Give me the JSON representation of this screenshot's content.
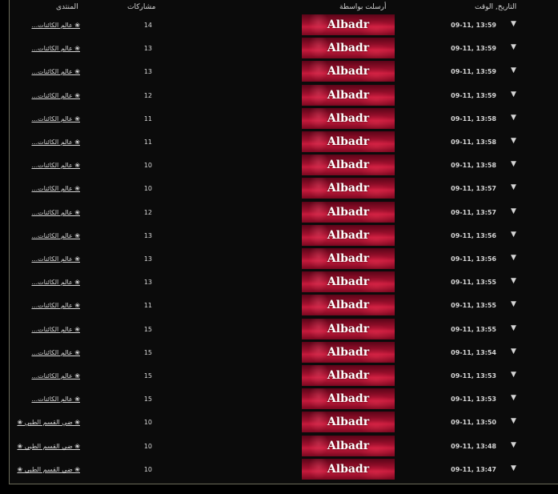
{
  "headers": {
    "forum": "المنتدى",
    "posts": "مشاركات",
    "sender": "أرسلت بواسطة",
    "date": "التاريخ, الوقت"
  },
  "arrow_icon": "▼",
  "banner_colors": [
    "#5a0418",
    "#c51a3c"
  ],
  "rows": [
    {
      "forum": "❀ عالم الكائنات...",
      "posts": "14",
      "sender": "Albadr",
      "date": "09-11, 13:59"
    },
    {
      "forum": "❀ عالم الكائنات...",
      "posts": "13",
      "sender": "Albadr",
      "date": "09-11, 13:59"
    },
    {
      "forum": "❀ عالم الكائنات...",
      "posts": "13",
      "sender": "Albadr",
      "date": "09-11, 13:59"
    },
    {
      "forum": "❀ عالم الكائنات...",
      "posts": "12",
      "sender": "Albadr",
      "date": "09-11, 13:59"
    },
    {
      "forum": "❀ عالم الكائنات...",
      "posts": "11",
      "sender": "Albadr",
      "date": "09-11, 13:58"
    },
    {
      "forum": "❀ عالم الكائنات...",
      "posts": "11",
      "sender": "Albadr",
      "date": "09-11, 13:58"
    },
    {
      "forum": "❀ عالم الكائنات...",
      "posts": "10",
      "sender": "Albadr",
      "date": "09-11, 13:58"
    },
    {
      "forum": "❀ عالم الكائنات...",
      "posts": "10",
      "sender": "Albadr",
      "date": "09-11, 13:57"
    },
    {
      "forum": "❀ عالم الكائنات...",
      "posts": "12",
      "sender": "Albadr",
      "date": "09-11, 13:57"
    },
    {
      "forum": "❀ عالم الكائنات...",
      "posts": "13",
      "sender": "Albadr",
      "date": "09-11, 13:56"
    },
    {
      "forum": "❀ عالم الكائنات...",
      "posts": "13",
      "sender": "Albadr",
      "date": "09-11, 13:56"
    },
    {
      "forum": "❀ عالم الكائنات...",
      "posts": "13",
      "sender": "Albadr",
      "date": "09-11, 13:55"
    },
    {
      "forum": "❀ عالم الكائنات...",
      "posts": "11",
      "sender": "Albadr",
      "date": "09-11, 13:55"
    },
    {
      "forum": "❀ عالم الكائنات...",
      "posts": "15",
      "sender": "Albadr",
      "date": "09-11, 13:55"
    },
    {
      "forum": "❀ عالم الكائنات...",
      "posts": "15",
      "sender": "Albadr",
      "date": "09-11, 13:54"
    },
    {
      "forum": "❀ عالم الكائنات...",
      "posts": "15",
      "sender": "Albadr",
      "date": "09-11, 13:53"
    },
    {
      "forum": "❀ عالم الكائنات...",
      "posts": "15",
      "sender": "Albadr",
      "date": "09-11, 13:53"
    },
    {
      "forum": "❀ ضي القسم الطبي ❀",
      "posts": "10",
      "sender": "Albadr",
      "date": "09-11, 13:50"
    },
    {
      "forum": "❀ ضي القسم الطبي ❀",
      "posts": "10",
      "sender": "Albadr",
      "date": "09-11, 13:48"
    },
    {
      "forum": "❀ ضي القسم الطبي ❀",
      "posts": "10",
      "sender": "Albadr",
      "date": "09-11, 13:47"
    }
  ]
}
